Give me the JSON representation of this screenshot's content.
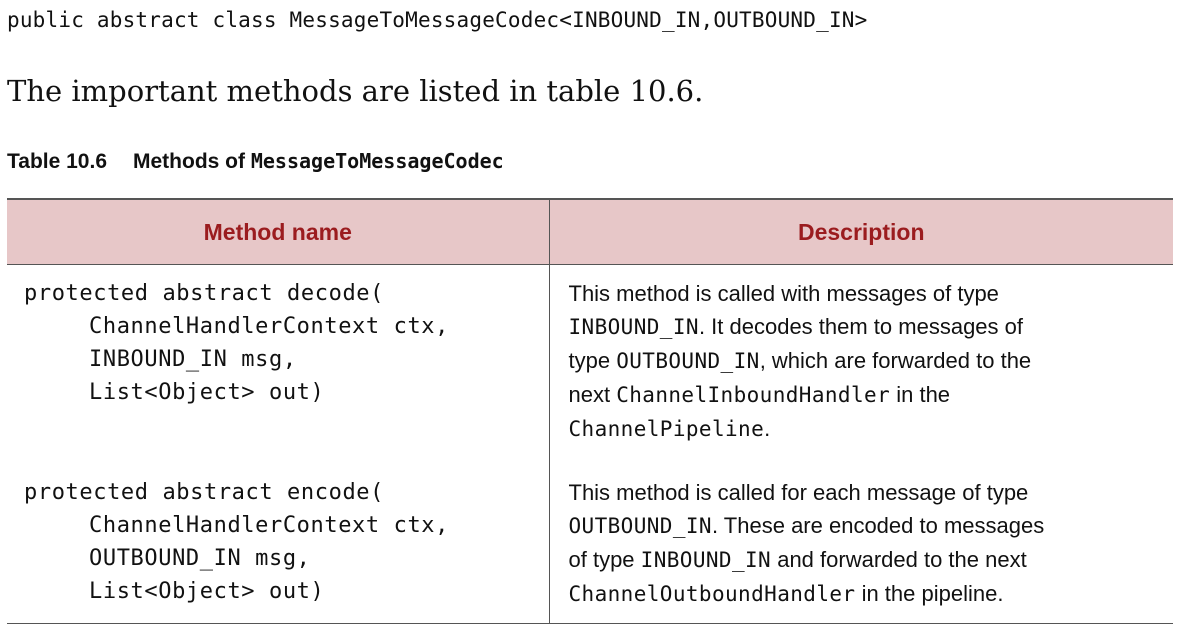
{
  "code_declaration": "public abstract class MessageToMessageCodec<INBOUND_IN,OUTBOUND_IN>",
  "intro_text": "The important methods are listed in table 10.6.",
  "caption": {
    "label": "Table 10.6",
    "text": "Methods of ",
    "code": "MessageToMessageCodec"
  },
  "table": {
    "headers": [
      "Method name",
      "Description"
    ],
    "rows": [
      {
        "signature": [
          "protected abstract decode(",
          "ChannelHandlerContext ctx,",
          "INBOUND_IN msg,",
          "List<Object> out)"
        ],
        "description": {
          "l1": "This method is called with messages of type",
          "l2_code": "INBOUND_IN",
          "l2_text": ". It decodes them to messages of",
          "l3_text": "type ",
          "l3_code": "OUTBOUND_IN",
          "l3_text2": ", which are forwarded to the",
          "l4_text": "next ",
          "l4_code": "ChannelInboundHandler",
          "l4_text2": " in the",
          "l5_code": "ChannelPipeline",
          "l5_text": "."
        }
      },
      {
        "signature": [
          "protected abstract encode(",
          "ChannelHandlerContext ctx,",
          "OUTBOUND_IN msg,",
          "List<Object> out)"
        ],
        "description": {
          "l1": "This method is called for each message of type",
          "l2_code": "OUTBOUND_IN",
          "l2_text": ". These are encoded to messages",
          "l3_text": "of type ",
          "l3_code": "INBOUND_IN",
          "l3_text2": " and forwarded to the next",
          "l4_code": "ChannelOutboundHandler",
          "l4_text": " in the pipeline."
        }
      }
    ]
  },
  "colors": {
    "header_background": "#e7c7c8",
    "header_text": "#9b1c1f",
    "rule": "#555555"
  }
}
